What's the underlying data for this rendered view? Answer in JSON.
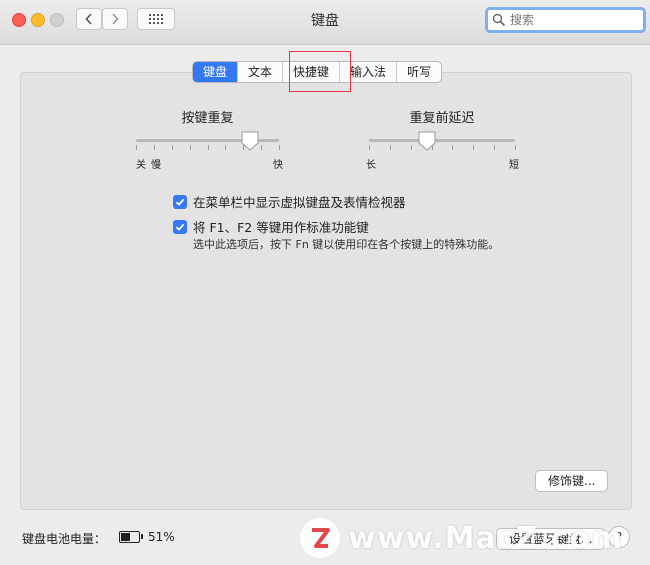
{
  "window": {
    "title": "键盘"
  },
  "search": {
    "placeholder": "搜索"
  },
  "tabs": [
    {
      "label": "键盘",
      "active": true
    },
    {
      "label": "文本",
      "active": false
    },
    {
      "label": "快捷键",
      "active": false
    },
    {
      "label": "输入法",
      "active": false
    },
    {
      "label": "听写",
      "active": false
    }
  ],
  "key_repeat": {
    "label": "按键重复",
    "left_labels": [
      "关",
      "慢"
    ],
    "right_label": "快",
    "level": 0.8
  },
  "repeat_delay": {
    "label": "重复前延迟",
    "left_label": "长",
    "right_label": "短",
    "level": 0.4
  },
  "options": {
    "show_viewer": {
      "label": "在菜单栏中显示虚拟键盘及表情检视器",
      "checked": true
    },
    "fn_keys": {
      "label": "将 F1、F2 等键用作标准功能键",
      "checked": true,
      "hint": "选中此选项后，按下 Fn 键以使用印在各个按键上的特殊功能。"
    }
  },
  "buttons": {
    "modifier": "修饰键...",
    "bluetooth": "设置蓝牙键盘...",
    "help": "?"
  },
  "battery": {
    "label": "键盘电池电量：",
    "percent": "51%",
    "level": 0.51
  },
  "watermark": {
    "text": "www.MacZ.com"
  },
  "colors": {
    "accent": "#3478f6",
    "highlight": "#e23b3b"
  }
}
